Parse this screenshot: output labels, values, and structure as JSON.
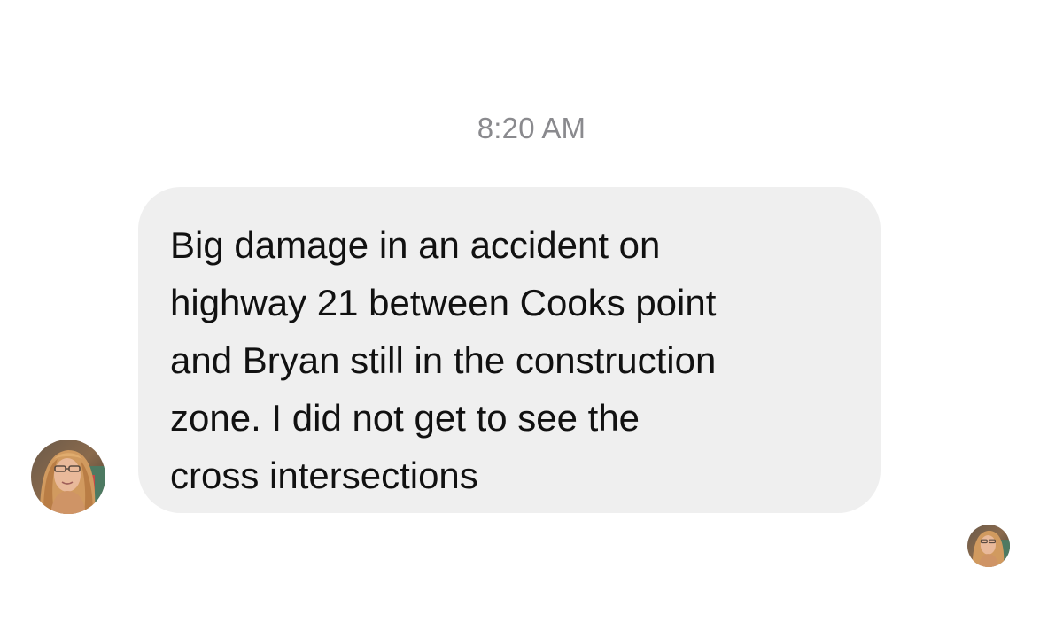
{
  "conversation": {
    "timestamp": "8:20 AM",
    "message": {
      "lines": [
        "Big damage in an accident on",
        "highway 21 between Cooks point",
        "and Bryan still in the construction",
        "zone. I did not get to see the",
        "cross intersections"
      ],
      "bubble_color": "#efefef",
      "text_color": "#111111"
    },
    "sender_avatar_icon": "profile-photo-avatar",
    "read_receipt_icon": "read-receipt-avatar"
  }
}
